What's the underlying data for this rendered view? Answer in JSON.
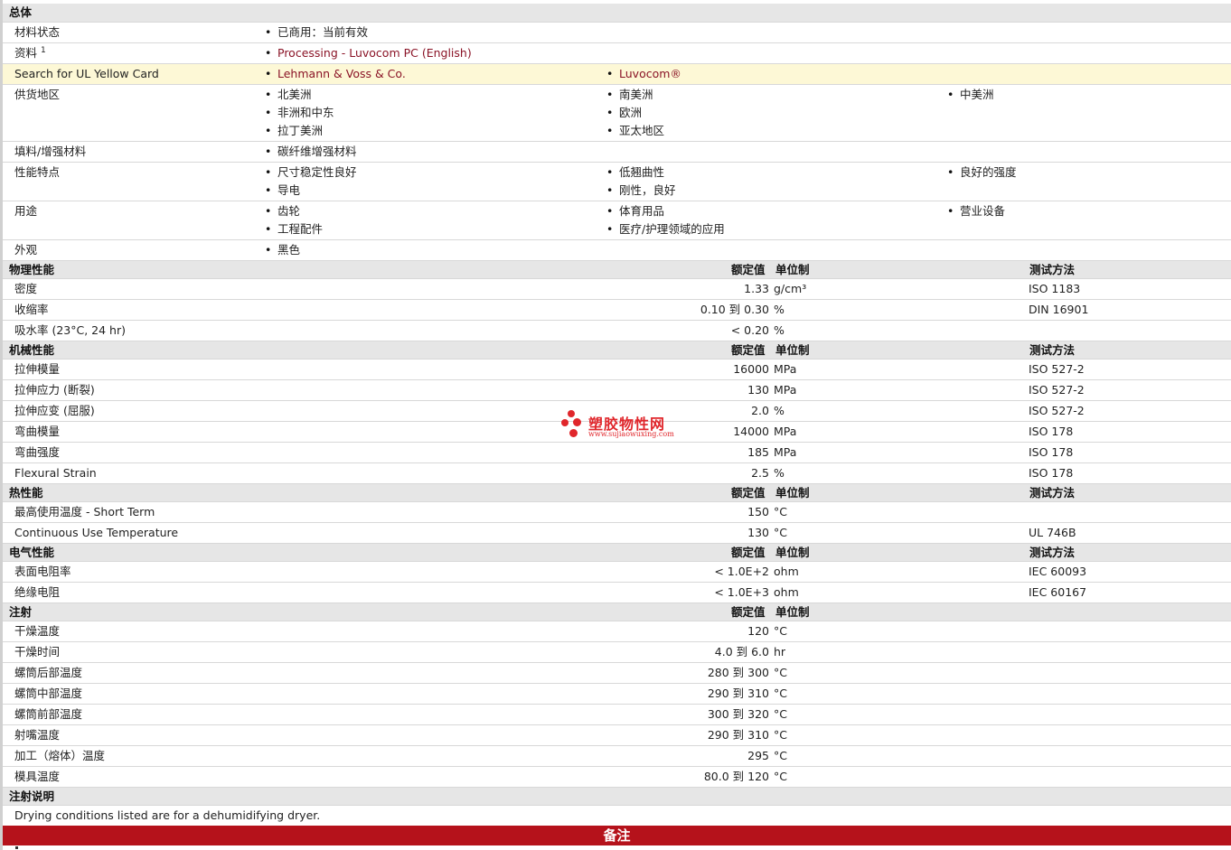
{
  "general": {
    "header": "总体",
    "status_label": "材料状态",
    "status_value": "已商用：当前有效",
    "docs_label": "资料",
    "docs_sup": "1",
    "docs_link": "Processing - Luvocom PC (English)",
    "ul_label": "Search for UL Yellow Card",
    "ul_links": [
      "Lehmann & Voss & Co.",
      "Luvocom®"
    ],
    "supply_label": "供货地区",
    "supply_items": [
      "北美洲",
      "南美洲",
      "中美洲",
      "非洲和中东",
      "欧洲",
      "拉丁美洲",
      "亚太地区"
    ],
    "filler_label": "填料/增强材料",
    "filler_value": "碳纤维增强材料",
    "features_label": "性能特点",
    "features_items": [
      "尺寸稳定性良好",
      "低翘曲性",
      "良好的强度",
      "导电",
      "刚性，良好"
    ],
    "uses_label": "用途",
    "uses_items": [
      "齿轮",
      "体育用品",
      "营业设备",
      "工程配件",
      "医疗/护理领域的应用"
    ],
    "appearance_label": "外观",
    "appearance_value": "黑色"
  },
  "col_headers": {
    "nominal": "额定值",
    "unit": "单位制",
    "test": "测试方法"
  },
  "physical": {
    "header": "物理性能",
    "rows": [
      {
        "label": "密度",
        "value": "1.33",
        "unit": "g/cm³",
        "test": "ISO 1183"
      },
      {
        "label": "收缩率",
        "value": "0.10 到  0.30",
        "unit": "%",
        "test": "DIN 16901"
      },
      {
        "label": "吸水率  (23°C, 24 hr)",
        "value": "< 0.20",
        "unit": "%",
        "test": ""
      }
    ]
  },
  "mechanical": {
    "header": "机械性能",
    "rows": [
      {
        "label": "拉伸模量",
        "value": "16000",
        "unit": "MPa",
        "test": "ISO 527-2"
      },
      {
        "label": "拉伸应力  (断裂)",
        "value": "130",
        "unit": "MPa",
        "test": "ISO 527-2"
      },
      {
        "label": "拉伸应变  (屈服)",
        "value": "2.0",
        "unit": "%",
        "test": "ISO 527-2"
      },
      {
        "label": "弯曲模量",
        "value": "14000",
        "unit": "MPa",
        "test": "ISO 178"
      },
      {
        "label": "弯曲强度",
        "value": "185",
        "unit": "MPa",
        "test": "ISO 178"
      },
      {
        "label": "Flexural Strain",
        "value": "2.5",
        "unit": "%",
        "test": "ISO 178"
      }
    ]
  },
  "thermal": {
    "header": "热性能",
    "rows": [
      {
        "label": "最高使用温度  - Short Term",
        "value": "150",
        "unit": "°C",
        "test": ""
      },
      {
        "label": "Continuous Use Temperature",
        "value": "130",
        "unit": "°C",
        "test": "UL 746B"
      }
    ]
  },
  "electrical": {
    "header": "电气性能",
    "rows": [
      {
        "label": "表面电阻率",
        "value": "< 1.0E+2",
        "unit": "ohm",
        "test": "IEC 60093"
      },
      {
        "label": "绝缘电阻",
        "value": "< 1.0E+3",
        "unit": "ohm",
        "test": "IEC 60167"
      }
    ]
  },
  "injection": {
    "header": "注射",
    "rows": [
      {
        "label": "干燥温度",
        "value": "120",
        "unit": "°C"
      },
      {
        "label": "干燥时间",
        "value": "4.0 到  6.0",
        "unit": "hr"
      },
      {
        "label": "螺筒后部温度",
        "value": "280 到  300",
        "unit": "°C"
      },
      {
        "label": "螺筒中部温度",
        "value": "290 到  310",
        "unit": "°C"
      },
      {
        "label": "螺筒前部温度",
        "value": "300 到  320",
        "unit": "°C"
      },
      {
        "label": "射嘴温度",
        "value": "290 到  310",
        "unit": "°C"
      },
      {
        "label": "加工（熔体）温度",
        "value": "295",
        "unit": "°C"
      },
      {
        "label": "模具温度",
        "value": "80.0 到  120",
        "unit": "°C"
      }
    ]
  },
  "injection_notes": {
    "header": "注射说明",
    "text": "Drying conditions listed are for a dehumidifying dryer."
  },
  "notes_bar": "备注",
  "watermark": {
    "title": "塑胶物性网",
    "url": "www.sujiaowuxing.com"
  },
  "colors": {
    "link": "#8a1326",
    "header_bg": "#e6e6e6",
    "highlight": "#fdf8d6",
    "notes_bar": "#b5121b"
  }
}
